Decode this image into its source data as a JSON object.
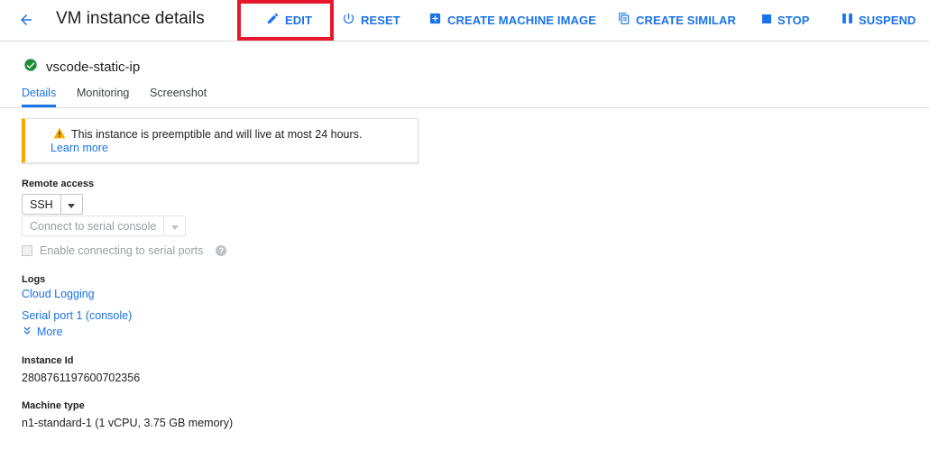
{
  "header": {
    "title": "VM instance details",
    "actions": {
      "edit": "EDIT",
      "reset": "RESET",
      "create_machine_image": "CREATE MACHINE IMAGE",
      "create_similar": "CREATE SIMILAR",
      "stop": "STOP",
      "suspend": "SUSPEND"
    }
  },
  "instance": {
    "name": "vscode-static-ip",
    "status_color": "#1e8e3e"
  },
  "tabs": [
    "Details",
    "Monitoring",
    "Screenshot"
  ],
  "notice": {
    "text": "This instance is preemptible and will live at most 24 hours.",
    "link": "Learn more",
    "accent": "#f9ab00"
  },
  "remote_access": {
    "label": "Remote access",
    "ssh": "SSH",
    "serial_console": "Connect to serial console",
    "enable_serial": "Enable connecting to serial ports"
  },
  "logs": {
    "label": "Logs",
    "cloud_logging": "Cloud Logging",
    "serial_port": "Serial port 1 (console)",
    "more": "More"
  },
  "instance_id": {
    "label": "Instance Id",
    "value": "2808761197600702356"
  },
  "machine_type": {
    "label": "Machine type",
    "value": "n1-standard-1 (1 vCPU, 3.75 GB memory)"
  },
  "accent_color": "#1a73e8"
}
